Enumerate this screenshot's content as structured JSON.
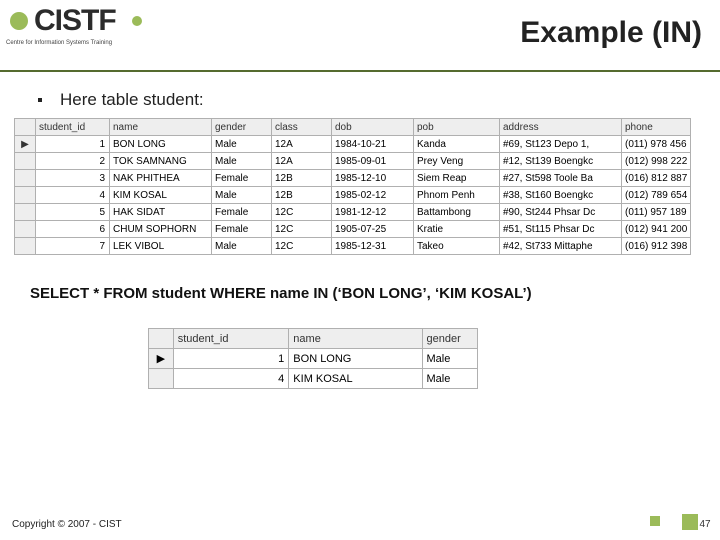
{
  "logo": {
    "main": "CISTF",
    "sub": "Centre for Information Systems Training"
  },
  "title": "Example (IN)",
  "bullet": "Here table student:",
  "table1": {
    "columns": [
      "student_id",
      "name",
      "gender",
      "class",
      "dob",
      "pob",
      "address",
      "phone"
    ],
    "rows": [
      {
        "sel": "▶",
        "id": "1",
        "name": "BON LONG",
        "gender": "Male",
        "class": "12A",
        "dob": "1984-10-21",
        "pob": "Kanda",
        "address": "#69, St123 Depo 1,",
        "phone": "(011) 978 456"
      },
      {
        "sel": "",
        "id": "2",
        "name": "TOK SAMNANG",
        "gender": "Male",
        "class": "12A",
        "dob": "1985-09-01",
        "pob": "Prey Veng",
        "address": "#12, St139 Boengkc",
        "phone": "(012) 998 222"
      },
      {
        "sel": "",
        "id": "3",
        "name": "NAK PHITHEA",
        "gender": "Female",
        "class": "12B",
        "dob": "1985-12-10",
        "pob": "Siem Reap",
        "address": "#27, St598 Toole Ba",
        "phone": "(016) 812 887"
      },
      {
        "sel": "",
        "id": "4",
        "name": "KIM KOSAL",
        "gender": "Male",
        "class": "12B",
        "dob": "1985-02-12",
        "pob": "Phnom Penh",
        "address": "#38, St160 Boengkc",
        "phone": "(012) 789 654"
      },
      {
        "sel": "",
        "id": "5",
        "name": "HAK SIDAT",
        "gender": "Female",
        "class": "12C",
        "dob": "1981-12-12",
        "pob": "Battambong",
        "address": "#90, St244 Phsar Dc",
        "phone": "(011) 957 189"
      },
      {
        "sel": "",
        "id": "6",
        "name": "CHUM SOPHORN",
        "gender": "Female",
        "class": "12C",
        "dob": "1905-07-25",
        "pob": "Kratie",
        "address": "#51, St115 Phsar Dc",
        "phone": "(012) 941 200"
      },
      {
        "sel": "",
        "id": "7",
        "name": "LEK VIBOL",
        "gender": "Male",
        "class": "12C",
        "dob": "1985-12-31",
        "pob": "Takeo",
        "address": "#42, St733 Mittaphe",
        "phone": "(016) 912 398"
      }
    ]
  },
  "sql": "SELECT * FROM student WHERE name IN (‘BON LONG’, ‘KIM KOSAL’)",
  "table2": {
    "columns": [
      "student_id",
      "name",
      "gender"
    ],
    "rows": [
      {
        "sel": "▶",
        "id": "1",
        "name": "BON LONG",
        "gender": "Male"
      },
      {
        "sel": "",
        "id": "4",
        "name": "KIM KOSAL",
        "gender": "Male"
      }
    ]
  },
  "footer": {
    "copyright": "Copyright © 2007 - CIST",
    "page": "47"
  }
}
